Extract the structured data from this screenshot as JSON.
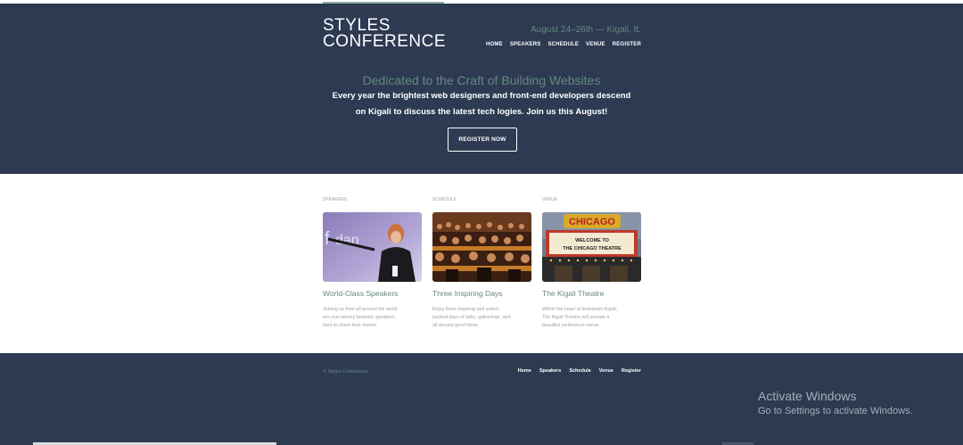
{
  "logo": {
    "line1": "STYLES",
    "line2": "CONFERENCE"
  },
  "header": {
    "dates": "August 24–26th — Kigali, IL",
    "nav": [
      "HOME",
      "SPEAKERS",
      "SCHEDULE",
      "VENUE",
      "REGISTER"
    ]
  },
  "hero": {
    "title": "Dedicated to the Craft of Building Websites",
    "line1": "Every year the brightest web designers and front-end developers descend",
    "line2": "on Kigali to discuss the latest tech logies. Join us this August!",
    "button": "REGISTER NOW"
  },
  "columns": [
    {
      "label": "SPEAKERS",
      "image": "speaker-photo",
      "heading": "World-Class Speakers",
      "desc1": "Joining us from all around the world",
      "desc2": "are over twenty fantastic speakers,",
      "desc3": "here to share their stories."
    },
    {
      "label": "SCHEDULE",
      "image": "audience-photo",
      "heading": "Three Inspiring Days",
      "desc1": "Enjoy three inspiring and action-",
      "desc2": "packed days of talks, gatherings, and",
      "desc3": "all-around good times."
    },
    {
      "label": "VENUE",
      "image": "theatre-photo",
      "heading": "The Kigali Theatre",
      "desc1": "Within the heart of downtown Kigali,",
      "desc2": "The Kigali Theatre will provide a",
      "desc3": "beautiful conference venue.",
      "marquee_top": "CHICAGO",
      "marquee_1": "WELCOME TO",
      "marquee_2": "THE CHICAGO THEATRE"
    }
  ],
  "footer": {
    "copyright": "© Styles Conference",
    "nav": [
      "Home",
      "Speakers",
      "Schedule",
      "Venue",
      "Register"
    ]
  },
  "watermark": {
    "title": "Activate Windows",
    "subtitle": "Go to Settings to activate Windows."
  },
  "colors": {
    "navy": "#2d3a52",
    "accent_green": "#648880",
    "muted_text": "#9aa3ad"
  }
}
